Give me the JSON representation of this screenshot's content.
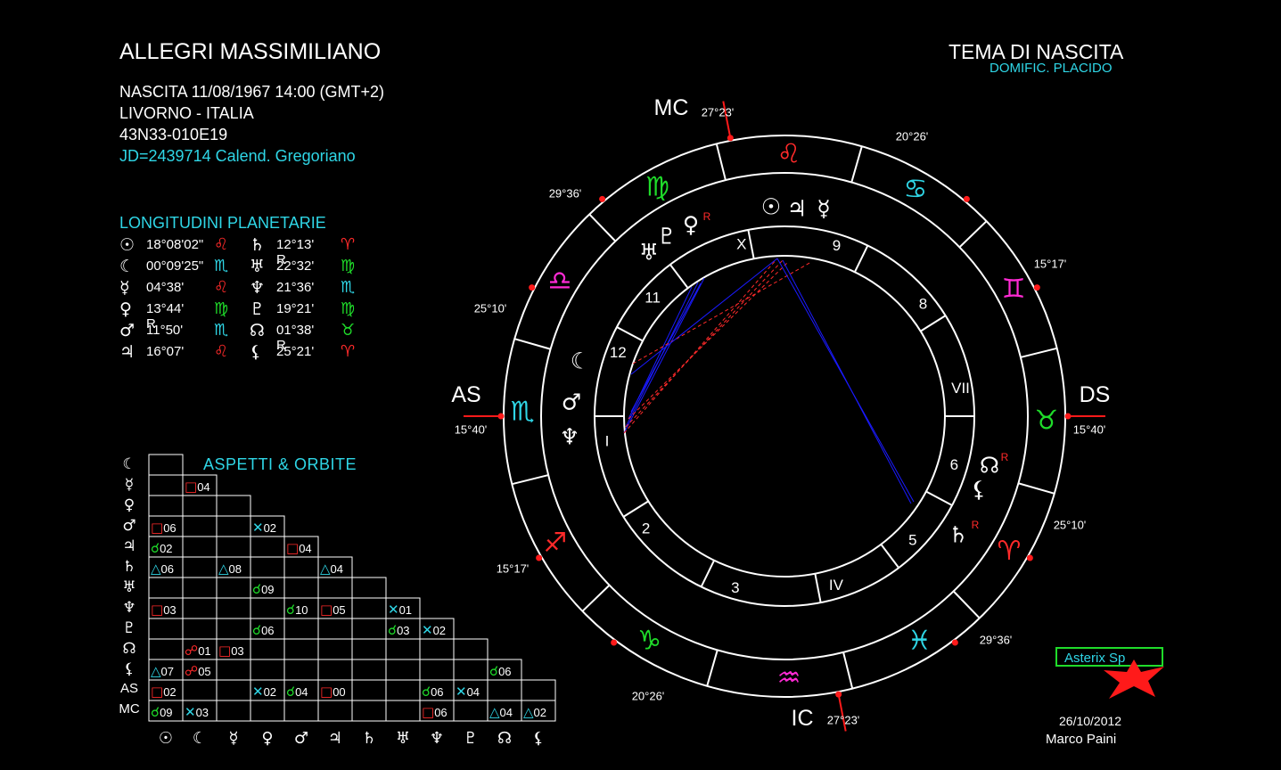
{
  "header": {
    "name": "ALLEGRI MASSIMILIANO",
    "birth": "NASCITA 11/08/1967 14:00 (GMT+2)",
    "place": "LIVORNO - ITALIA",
    "coords": "43N33-010E19",
    "jd": "JD=2439714  Calend. Gregoriano",
    "chart_title": "TEMA DI NASCITA",
    "domific": "DOMIFIC. PLACIDO"
  },
  "longitudes": {
    "title": "LONGITUDINI PLANETARIE",
    "left": [
      {
        "planet": "☉",
        "degree": "18°08'02\"",
        "sign": "♌",
        "color": "#ff2a2a"
      },
      {
        "planet": "☾",
        "degree": "00°09'25\"",
        "sign": "♏",
        "color": "#2fd6e6"
      },
      {
        "planet": "☿",
        "degree": "04°38'",
        "sign": "♌",
        "color": "#ff2a2a"
      },
      {
        "planet": "♀",
        "degree": "13°44' R",
        "sign": "♍",
        "color": "#1fdc2a"
      },
      {
        "planet": "♂",
        "degree": "11°50'",
        "sign": "♏",
        "color": "#2fd6e6"
      },
      {
        "planet": "♃",
        "degree": "16°07'",
        "sign": "♌",
        "color": "#ff2a2a"
      }
    ],
    "right": [
      {
        "planet": "♄",
        "degree": "12°13' R",
        "sign": "♈",
        "color": "#ff2a2a"
      },
      {
        "planet": "♅",
        "degree": "22°32'",
        "sign": "♍",
        "color": "#1fdc2a"
      },
      {
        "planet": "♆",
        "degree": "21°36'",
        "sign": "♏",
        "color": "#2fd6e6"
      },
      {
        "planet": "♇",
        "degree": "19°21'",
        "sign": "♍",
        "color": "#1fdc2a"
      },
      {
        "planet": "☊",
        "degree": "01°38' R",
        "sign": "♉",
        "color": "#1fdc2a"
      },
      {
        "planet": "⚸",
        "degree": "25°21'",
        "sign": "♈",
        "color": "#ff2a2a"
      }
    ]
  },
  "aspects": {
    "title": "ASPETTI  &  ORBITE",
    "row_labels": [
      "☾",
      "☿",
      "♀",
      "♂",
      "♃",
      "♄",
      "♅",
      "♆",
      "♇",
      "☊",
      "⚸",
      "AS",
      "MC"
    ],
    "col_labels": [
      "☉",
      "☾",
      "☿",
      "♀",
      "♂",
      "♃",
      "♄",
      "♅",
      "♆",
      "♇",
      "☊",
      "⚸"
    ],
    "cells": [
      {
        "r": 1,
        "c": 1,
        "sym": "□",
        "color": "#ff2a2a",
        "orb": "04"
      },
      {
        "r": 3,
        "c": 0,
        "sym": "□",
        "color": "#ff2a2a",
        "orb": "06"
      },
      {
        "r": 3,
        "c": 3,
        "sym": "✕",
        "color": "#2fd6e6",
        "orb": "02"
      },
      {
        "r": 4,
        "c": 0,
        "sym": "☌",
        "color": "#1fdc2a",
        "orb": "02"
      },
      {
        "r": 4,
        "c": 4,
        "sym": "□",
        "color": "#ff2a2a",
        "orb": "04"
      },
      {
        "r": 5,
        "c": 0,
        "sym": "△",
        "color": "#2fd6e6",
        "orb": "06"
      },
      {
        "r": 5,
        "c": 2,
        "sym": "△",
        "color": "#2fd6e6",
        "orb": "08"
      },
      {
        "r": 5,
        "c": 5,
        "sym": "△",
        "color": "#2fd6e6",
        "orb": "04"
      },
      {
        "r": 6,
        "c": 3,
        "sym": "☌",
        "color": "#1fdc2a",
        "orb": "09"
      },
      {
        "r": 7,
        "c": 0,
        "sym": "□",
        "color": "#ff2a2a",
        "orb": "03"
      },
      {
        "r": 7,
        "c": 4,
        "sym": "☌",
        "color": "#1fdc2a",
        "orb": "10"
      },
      {
        "r": 7,
        "c": 5,
        "sym": "□",
        "color": "#ff2a2a",
        "orb": "05"
      },
      {
        "r": 7,
        "c": 7,
        "sym": "✕",
        "color": "#2fd6e6",
        "orb": "01"
      },
      {
        "r": 8,
        "c": 3,
        "sym": "☌",
        "color": "#1fdc2a",
        "orb": "06"
      },
      {
        "r": 8,
        "c": 7,
        "sym": "☌",
        "color": "#1fdc2a",
        "orb": "03"
      },
      {
        "r": 8,
        "c": 8,
        "sym": "✕",
        "color": "#2fd6e6",
        "orb": "02"
      },
      {
        "r": 9,
        "c": 1,
        "sym": "☍",
        "color": "#ff2a2a",
        "orb": "01"
      },
      {
        "r": 9,
        "c": 2,
        "sym": "□",
        "color": "#ff2a2a",
        "orb": "03"
      },
      {
        "r": 10,
        "c": 0,
        "sym": "△",
        "color": "#2fd6e6",
        "orb": "07"
      },
      {
        "r": 10,
        "c": 1,
        "sym": "☍",
        "color": "#ff2a2a",
        "orb": "05"
      },
      {
        "r": 10,
        "c": 10,
        "sym": "☌",
        "color": "#1fdc2a",
        "orb": "06"
      },
      {
        "r": 11,
        "c": 0,
        "sym": "□",
        "color": "#ff2a2a",
        "orb": "02"
      },
      {
        "r": 11,
        "c": 3,
        "sym": "✕",
        "color": "#2fd6e6",
        "orb": "02"
      },
      {
        "r": 11,
        "c": 4,
        "sym": "☌",
        "color": "#1fdc2a",
        "orb": "04"
      },
      {
        "r": 11,
        "c": 5,
        "sym": "□",
        "color": "#ff2a2a",
        "orb": "00"
      },
      {
        "r": 11,
        "c": 8,
        "sym": "☌",
        "color": "#1fdc2a",
        "orb": "06"
      },
      {
        "r": 11,
        "c": 9,
        "sym": "✕",
        "color": "#2fd6e6",
        "orb": "04"
      },
      {
        "r": 12,
        "c": 0,
        "sym": "☌",
        "color": "#1fdc2a",
        "orb": "09"
      },
      {
        "r": 12,
        "c": 1,
        "sym": "✕",
        "color": "#2fd6e6",
        "orb": "03"
      },
      {
        "r": 12,
        "c": 8,
        "sym": "□",
        "color": "#ff2a2a",
        "orb": "06"
      },
      {
        "r": 12,
        "c": 10,
        "sym": "△",
        "color": "#2fd6e6",
        "orb": "04"
      },
      {
        "r": 12,
        "c": 11,
        "sym": "△",
        "color": "#2fd6e6",
        "orb": "02"
      }
    ]
  },
  "wheel": {
    "angles": [
      {
        "label": "MC",
        "degree": "27°23'"
      },
      {
        "label": "AS",
        "degree": "15°40'"
      },
      {
        "label": "DS",
        "degree": "15°40'"
      },
      {
        "label": "IC",
        "degree": "27°23'"
      }
    ],
    "cusp_degrees": [
      "20°26'",
      "15°17'",
      "25°10'",
      "29°36'",
      "20°26'",
      "15°17'",
      "25°10'",
      "29°36'"
    ],
    "signs": [
      {
        "glyph": "♌",
        "color": "#ff2a2a"
      },
      {
        "glyph": "♋",
        "color": "#2fd6e6"
      },
      {
        "glyph": "♊",
        "color": "#ff2ad4"
      },
      {
        "glyph": "♉",
        "color": "#1fdc2a"
      },
      {
        "glyph": "♈",
        "color": "#ff2a2a"
      },
      {
        "glyph": "♓",
        "color": "#2fd6e6"
      },
      {
        "glyph": "♒",
        "color": "#ff2ad4"
      },
      {
        "glyph": "♑",
        "color": "#1fdc2a"
      },
      {
        "glyph": "♐",
        "color": "#ff2a2a"
      },
      {
        "glyph": "♏",
        "color": "#2fd6e6"
      },
      {
        "glyph": "♎",
        "color": "#ff2ad4"
      },
      {
        "glyph": "♍",
        "color": "#1fdc2a"
      }
    ],
    "houses": [
      "I",
      "2",
      "3",
      "IV",
      "5",
      "6",
      "VII",
      "8",
      "9",
      "X",
      "11",
      "12"
    ],
    "planets": [
      {
        "glyph": "☉",
        "retro": ""
      },
      {
        "glyph": "♃",
        "retro": ""
      },
      {
        "glyph": "☿",
        "retro": ""
      },
      {
        "glyph": "♀",
        "retro": "R"
      },
      {
        "glyph": "♇",
        "retro": ""
      },
      {
        "glyph": "♅",
        "retro": ""
      },
      {
        "glyph": "☾",
        "retro": ""
      },
      {
        "glyph": "♂",
        "retro": ""
      },
      {
        "glyph": "♆",
        "retro": ""
      },
      {
        "glyph": "☊",
        "retro": "R"
      },
      {
        "glyph": "⚸",
        "retro": ""
      },
      {
        "glyph": "♄",
        "retro": "R"
      }
    ]
  },
  "footer": {
    "logo": "Asterix Sp",
    "date": "26/10/2012",
    "author": "Marco Paini"
  }
}
